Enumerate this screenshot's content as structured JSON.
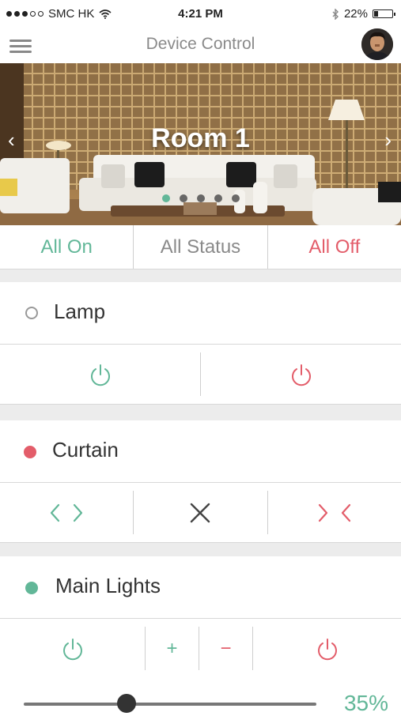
{
  "status_bar": {
    "carrier": "SMC HK",
    "time": "4:21 PM",
    "battery": "22%",
    "battery_level": 0.22
  },
  "nav": {
    "title": "Device Control"
  },
  "hero": {
    "room": "Room 1",
    "prev": "‹",
    "next": "›",
    "page_count": 5,
    "active_page": 0
  },
  "quick_actions": {
    "all_on": "All On",
    "all_status": "All Status",
    "all_off": "All Off"
  },
  "colors": {
    "green": "#62b798",
    "red": "#e35d6a",
    "gray": "#888888"
  },
  "devices": {
    "lamp": {
      "label": "Lamp",
      "state": "off"
    },
    "curtain": {
      "label": "Curtain",
      "state": "red"
    },
    "main_lights": {
      "label": "Main Lights",
      "state": "on",
      "plus": "+",
      "minus": "−",
      "level": "35%",
      "level_value": 0.35
    }
  }
}
